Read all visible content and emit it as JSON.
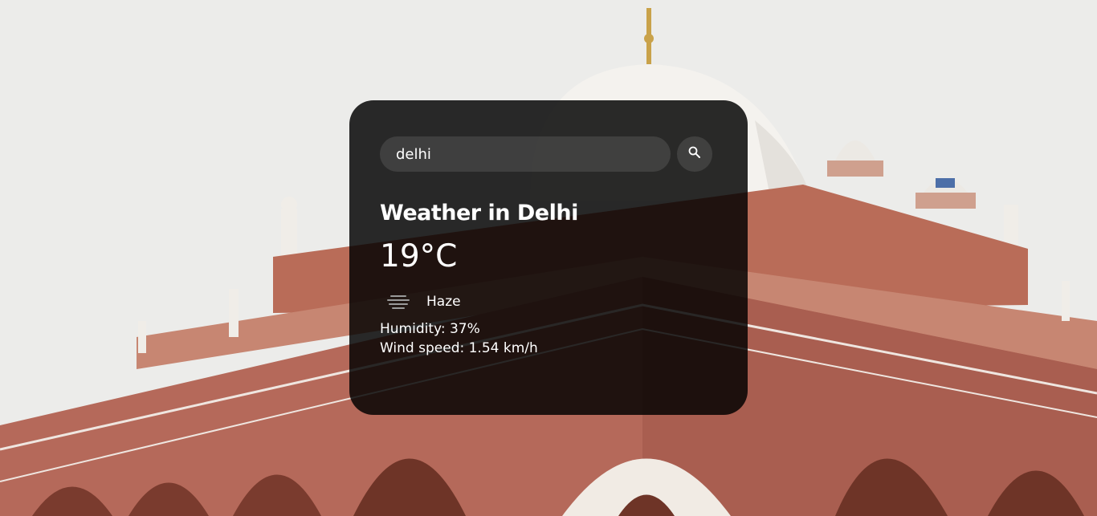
{
  "search": {
    "value": "delhi",
    "placeholder": "Search"
  },
  "weather": {
    "title": "Weather in Delhi",
    "temperature": "19°C",
    "description": "Haze",
    "description_icon": "haze-icon",
    "humidity": "Humidity: 37%",
    "wind": "Wind speed: 1.54 km/h"
  },
  "background": {
    "subject": "Humayun's Tomb, red sandstone with white marble dome",
    "sky_color": "#ececea",
    "sandstone_color": "#b9705c"
  }
}
